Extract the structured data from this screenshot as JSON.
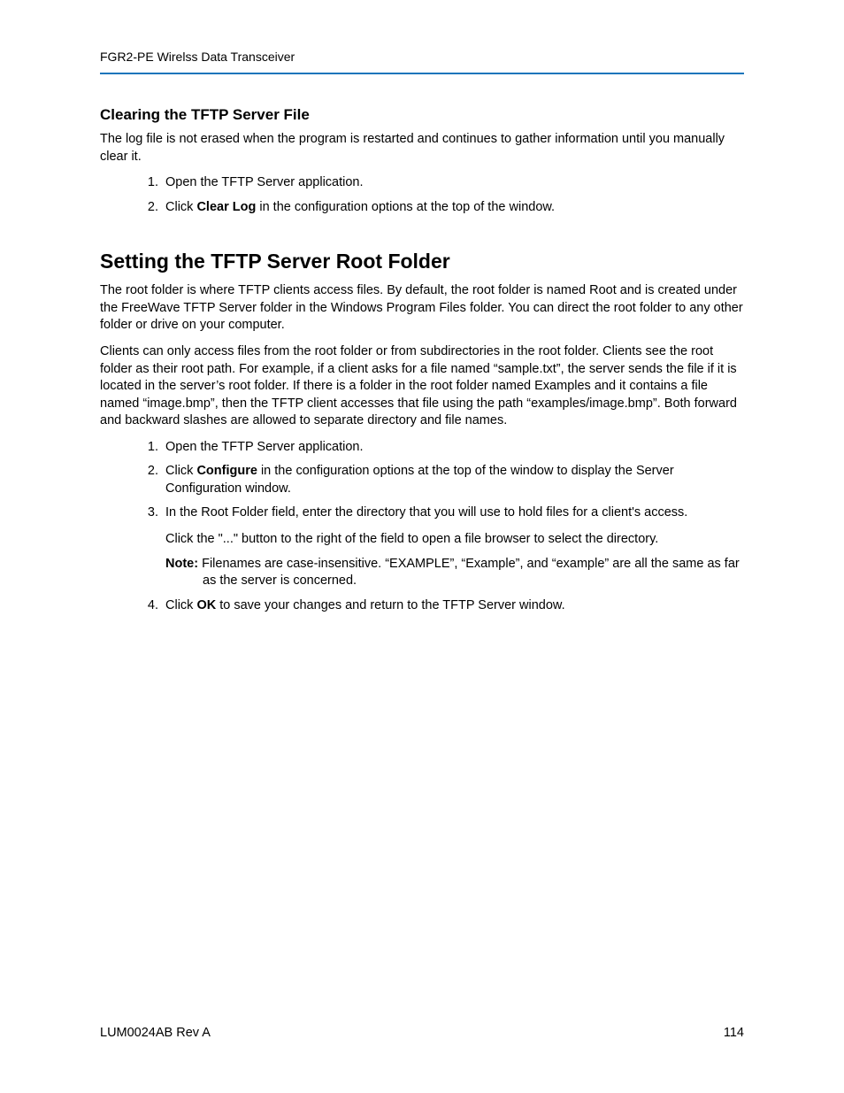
{
  "header": "FGR2-PE Wirelss Data Transceiver",
  "section1": {
    "title": "Clearing the TFTP Server File",
    "intro": "The log file is not erased when the program is restarted and continues to gather information until you manually clear it.",
    "steps": [
      {
        "text": "Open the TFTP Server application."
      },
      {
        "pre": "Click ",
        "bold": "Clear Log",
        "post": " in the configuration options at the top of the window."
      }
    ]
  },
  "section2": {
    "title": "Setting the TFTP Server Root Folder",
    "p1": "The root folder is where TFTP clients access files. By default, the root folder is named Root and is created under the FreeWave TFTP Server folder in the Windows Program Files folder. You can direct the root folder to any other folder or drive on your computer.",
    "p2": "Clients can only access files from the root folder or from subdirectories in the root folder. Clients see the root folder as their root path. For example, if a client asks for a file named “sample.txt”, the server sends the file if it is located in the server’s root folder. If there is a folder in the root folder named Examples and it contains a file named “image.bmp”, then the TFTP client accesses that file using the path “examples/image.bmp”. Both forward and backward slashes are allowed to separate directory and file names.",
    "steps": [
      {
        "text": "Open the TFTP Server application."
      },
      {
        "pre": "Click ",
        "bold": "Configure",
        "post": " in the configuration options at the top of the window to display the Server Configuration window."
      },
      {
        "text": "In the Root Folder field, enter the directory that you will use to hold files for a client's access.",
        "sub": "Click the \"...\" button to the right of the field to open a file browser to select the directory.",
        "note_label": "Note:",
        "note_text": " Filenames are case-insensitive. “EXAMPLE”, “Example”, and “example” are all the same as far as the server is concerned."
      },
      {
        "pre": "Click ",
        "bold": "OK",
        "post": " to save your changes and return to the TFTP Server window."
      }
    ]
  },
  "footer": {
    "left": "LUM0024AB Rev A",
    "right": "114"
  }
}
